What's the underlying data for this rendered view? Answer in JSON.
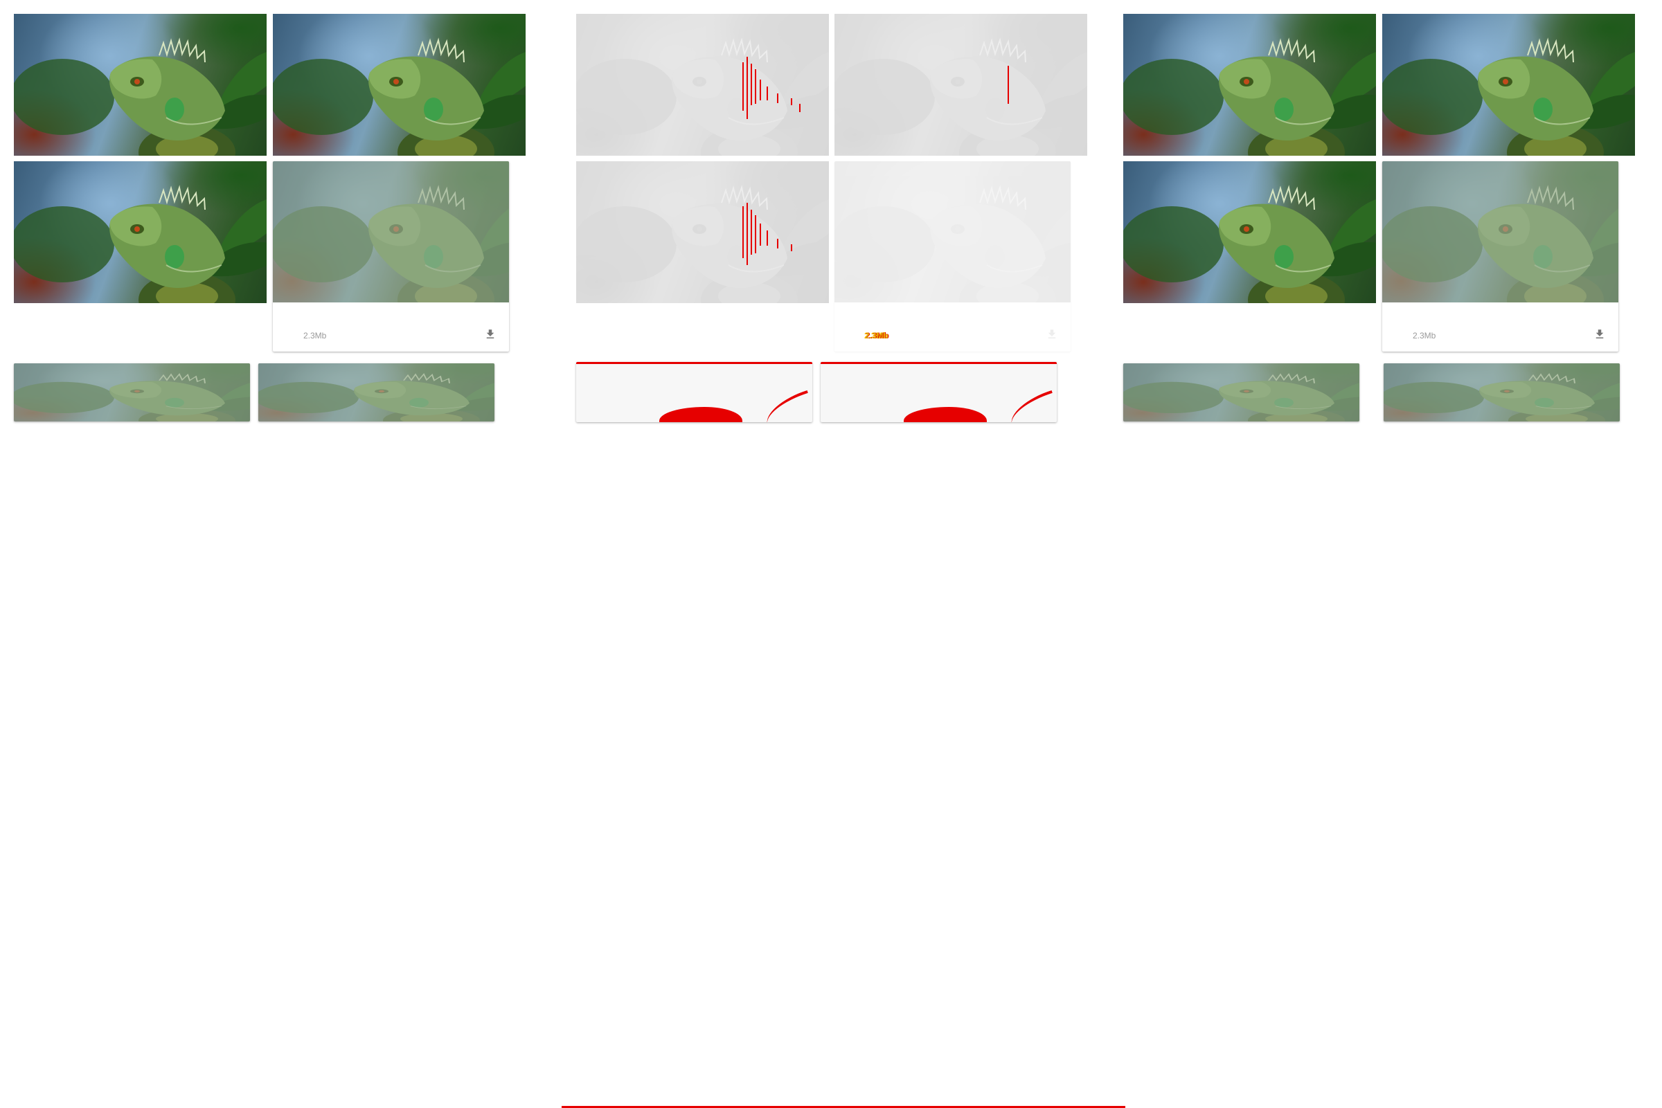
{
  "panels": [
    {
      "id": "actual",
      "cards": [
        {
          "size_label": "2.3Mb"
        }
      ]
    },
    {
      "id": "diff",
      "cards": [
        {
          "size_label": "2.3Mb"
        }
      ]
    },
    {
      "id": "expected",
      "cards": [
        {
          "size_label": "2.3Mb"
        }
      ]
    }
  ],
  "colors": {
    "diff_highlight": "#e60000",
    "diff_text_yellow": "#e0a000",
    "divider": "#c8c8c8"
  },
  "icons": {
    "download": "download-icon"
  }
}
